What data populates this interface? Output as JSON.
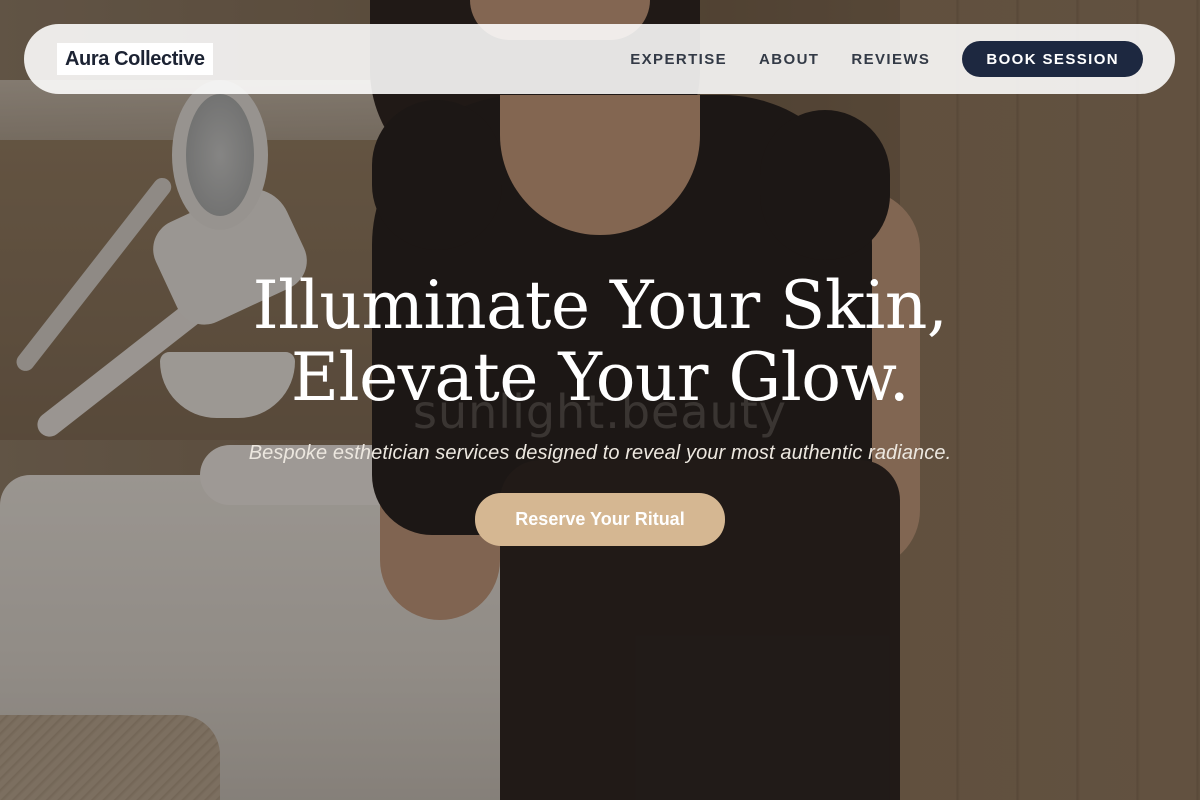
{
  "brand": {
    "name": "Aura Collective"
  },
  "nav": {
    "links": [
      {
        "label": "EXPERTISE"
      },
      {
        "label": "ABOUT"
      },
      {
        "label": "REVIEWS"
      }
    ],
    "book_button": "BOOK SESSION"
  },
  "hero": {
    "headline_line1": "Illuminate Your Skin,",
    "headline_line2": "Elevate Your Glow.",
    "subtitle": "Bespoke esthetician services designed to reveal your most authentic radiance.",
    "cta_label": "Reserve Your Ritual",
    "background_watermark": "sunlight.beauty"
  },
  "colors": {
    "nav_background": "#ffffff",
    "primary_button": "#1d2840",
    "accent_button": "#d5b792",
    "text_light": "#ffffff"
  }
}
